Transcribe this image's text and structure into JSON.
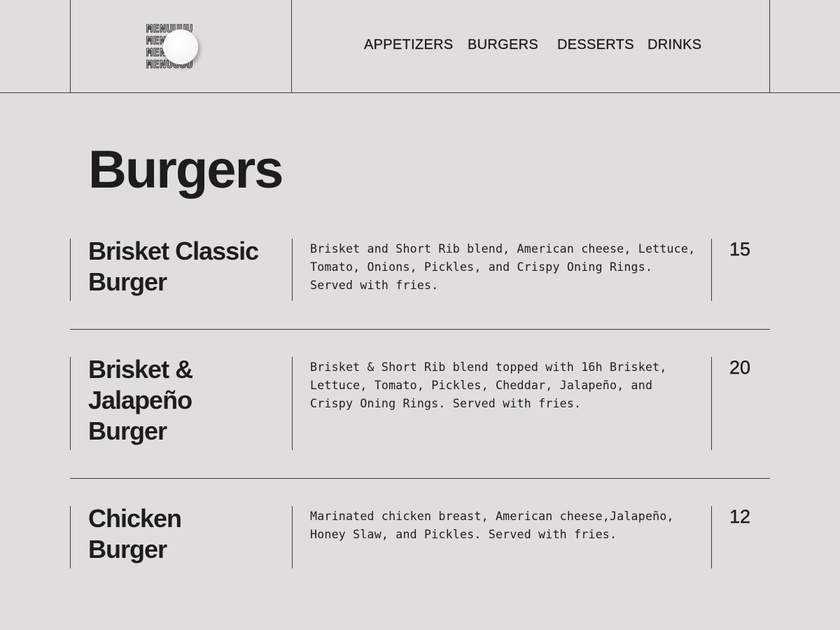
{
  "logo": {
    "lines": [
      "MENUUUU",
      "MENUUUU",
      "MENUUUU",
      "MENUUUU"
    ]
  },
  "nav": {
    "items": [
      {
        "label": "APPETIZERS"
      },
      {
        "label": "BURGERS"
      },
      {
        "label": "DESSERTS"
      },
      {
        "label": "DRINKS"
      }
    ]
  },
  "page": {
    "title": "Burgers"
  },
  "menu": {
    "items": [
      {
        "name": "Brisket Classic Burger",
        "description": "Brisket and Short Rib blend, American cheese, Lettuce, Tomato, Onions, Pickles, and Crispy Oning Rings. Served with fries.",
        "price": "15"
      },
      {
        "name": "Brisket & Jalapeño Burger",
        "description": "Brisket & Short Rib blend topped with 16h Brisket, Lettuce, Tomato, Pickles, Cheddar, Jalapeño, and Crispy Oning Rings. Served with fries.",
        "price": "20"
      },
      {
        "name": "Chicken Burger",
        "description": "Marinated chicken breast, American cheese,Jalapeño, Honey Slaw, and Pickles. Served with fries.",
        "price": "12"
      }
    ]
  },
  "colors": {
    "background": "#dfdedb",
    "text": "#1d1d1b",
    "rule": "#3a3a38"
  }
}
